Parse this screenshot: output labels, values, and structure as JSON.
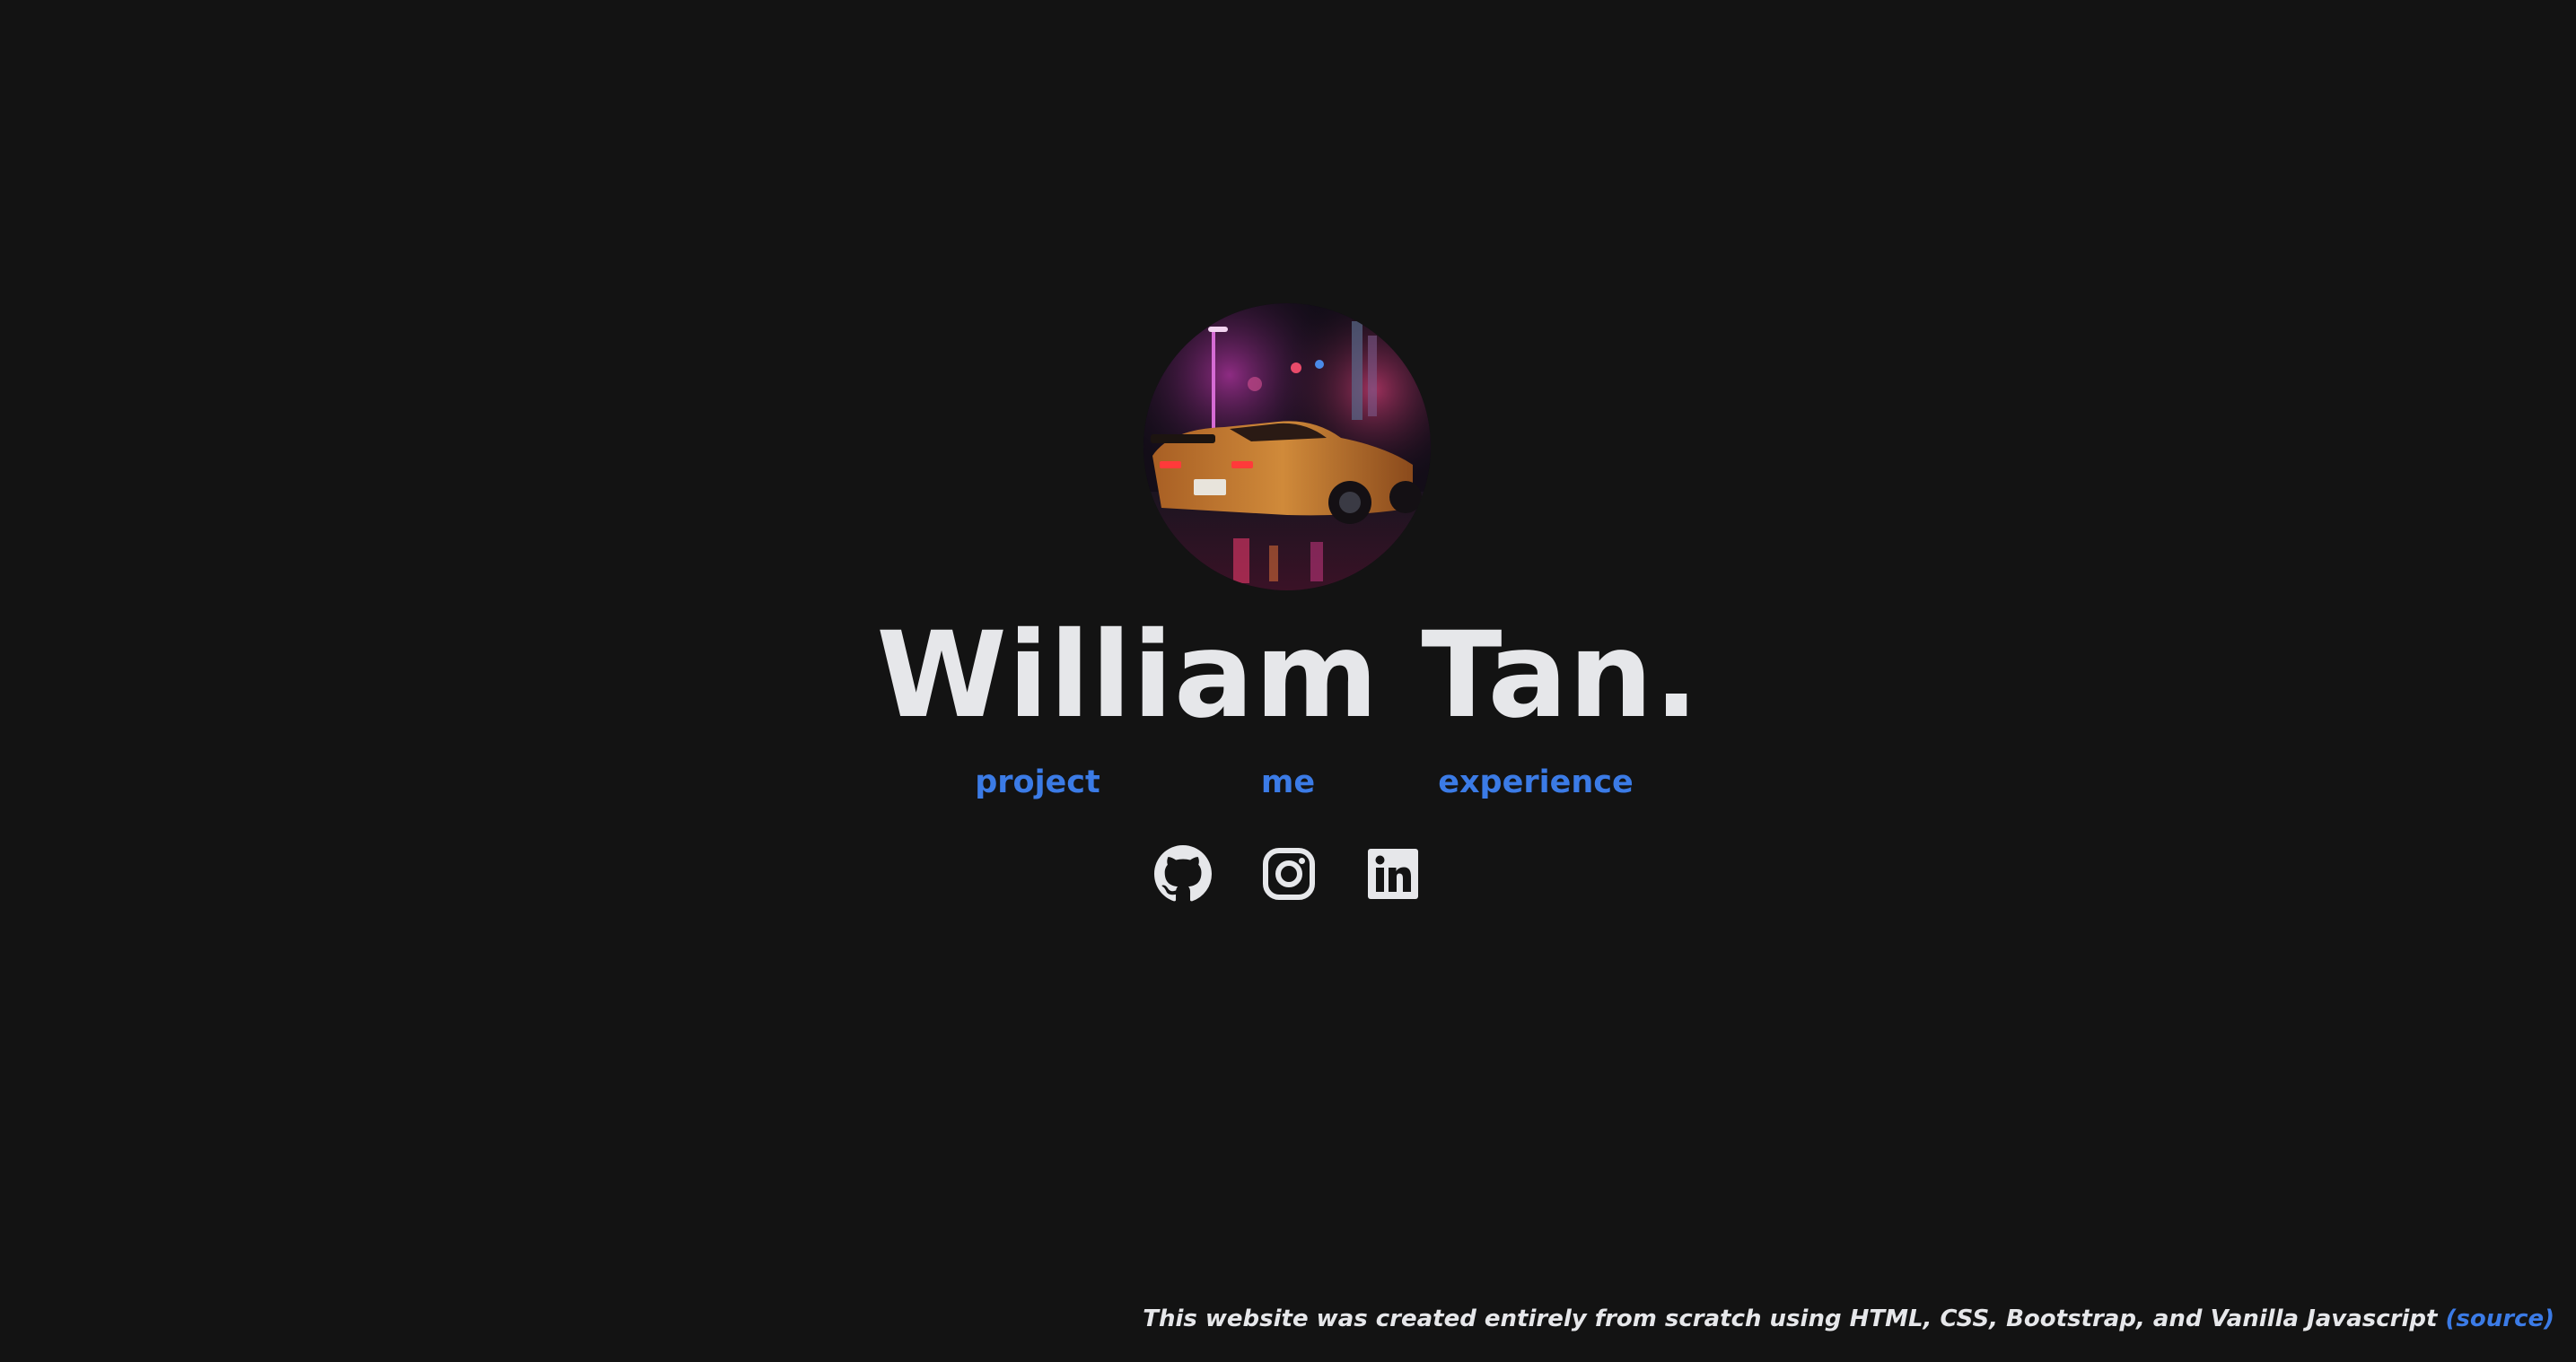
{
  "profile": {
    "name": "William Tan.",
    "avatar_icon": "sports-car-night-photo"
  },
  "nav": {
    "items": [
      {
        "label": "project"
      },
      {
        "label": "me"
      },
      {
        "label": "experience"
      }
    ]
  },
  "social": {
    "github_icon": "github-icon",
    "instagram_icon": "instagram-icon",
    "linkedin_icon": "linkedin-icon"
  },
  "footer": {
    "text": "This website was created entirely from scratch using HTML, CSS, Bootstrap, and Vanilla Javascript ",
    "source_label": "(source)"
  },
  "colors": {
    "background": "#131313",
    "text": "#e6e7ea",
    "accent": "#3b7be6"
  }
}
